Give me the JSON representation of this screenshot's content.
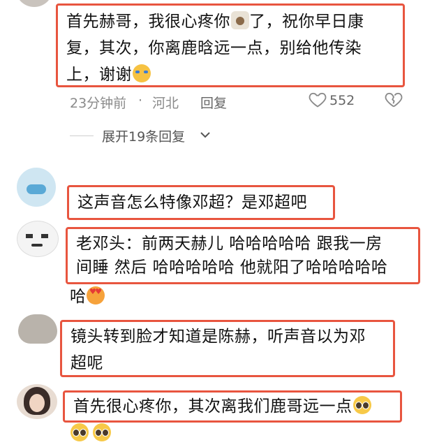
{
  "comments": [
    {
      "lines": [
        "首先赫哥，我很心疼你",
        "复，其次，你离鹿晗远一点，别给他传染",
        "上，谢谢"
      ],
      "line1_tail": "了，祝你早日康"
    },
    {
      "lines": [
        "这声音怎么特像邓超？是邓超吧"
      ]
    },
    {
      "lines": [
        "老邓头：前两天赫儿 哈哈哈哈哈 跟我一房",
        "间睡 然后 哈哈哈哈哈 他就阳了哈哈哈哈哈",
        "哈"
      ]
    },
    {
      "lines": [
        "镜头转到脸才知道是陈赫，听声音以为邓",
        "超呢"
      ]
    },
    {
      "lines": [
        "首先很心疼你，其次离我们鹿哥远一点"
      ]
    }
  ],
  "meta": {
    "time": "23分钟前",
    "dot": "·",
    "location": "河北",
    "reply": "回复",
    "likes": "552"
  },
  "expand_label": "展开19条回复",
  "icons": {
    "like": "heart-outline-icon",
    "dislike": "broken-heart-icon",
    "expand": "chevron-down-icon"
  },
  "colors": {
    "highlight_border": "#e8553f",
    "meta_text": "#8a8a8a"
  }
}
